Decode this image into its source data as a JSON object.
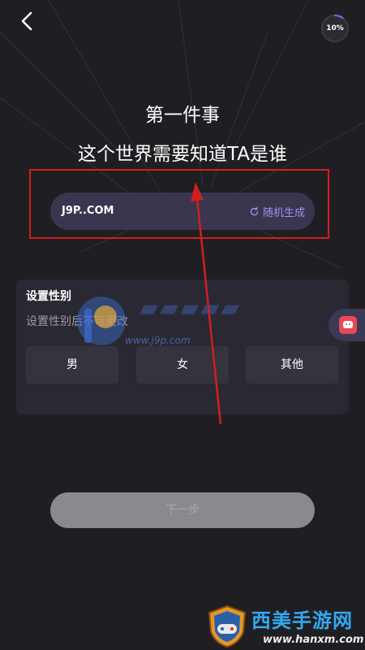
{
  "header": {
    "back_icon": "chevron-left-icon",
    "progress_label": "10%",
    "progress_fraction": 0.1,
    "progress_color": "#7c5cd6"
  },
  "titles": {
    "line1": "第一件事",
    "line2": "这个世界需要知道TA是谁"
  },
  "name_field": {
    "value": "J9P..COM",
    "random_label": "随机生成",
    "random_icon": "refresh-icon",
    "accent_color": "#a58fe6"
  },
  "gender": {
    "title": "设置性别",
    "subtitle": "设置性别后不可更改",
    "options": [
      "男",
      "女",
      "其他"
    ]
  },
  "watermark": {
    "logo_icon": "p-logo-icon",
    "url": "www.j9p.com"
  },
  "float_button": {
    "icon": "game-controller-icon"
  },
  "footer": {
    "next_label": "下一步"
  },
  "brand": {
    "name": "西美手游网",
    "url": "www.hanxm.com",
    "shield_icon": "gamepad-shield-icon"
  },
  "colors": {
    "background": "#1f1f23",
    "annotation_red": "#d21e1e"
  }
}
